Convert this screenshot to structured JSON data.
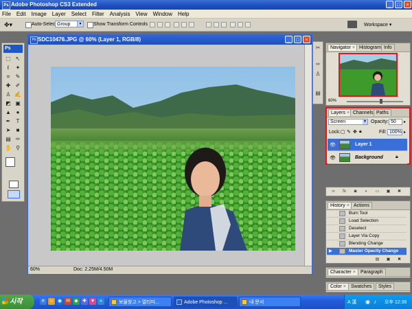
{
  "app": {
    "title": "Adobe Photoshop CS3 Extended",
    "logo": "Ps",
    "window_controls": [
      "_",
      "□",
      "×"
    ]
  },
  "menu": [
    "File",
    "Edit",
    "Image",
    "Layer",
    "Select",
    "Filter",
    "Analysis",
    "View",
    "Window",
    "Help"
  ],
  "options_bar": {
    "auto_select_label": "Auto-Select:",
    "auto_select_value": "Group",
    "show_transform_label": "Show Transform Controls",
    "workspace_label": "Workspace ▾"
  },
  "document": {
    "title": "SDC10476.JPG @ 60% (Layer 1, RGB/8)",
    "zoom": "60%",
    "doc_info": "Doc: 2.25M/4.50M"
  },
  "navigator": {
    "tabs": [
      "Navigator",
      "Histogram",
      "Info"
    ],
    "zoom": "60%"
  },
  "layers": {
    "tabs": [
      "Layers",
      "Channels",
      "Paths"
    ],
    "blend_mode": "Screen",
    "opacity_label": "Opacity:",
    "opacity_value": "50",
    "lock_label": "Lock:",
    "fill_label": "Fill:",
    "fill_value": "100%",
    "items": [
      {
        "name": "Layer 1",
        "selected": true
      },
      {
        "name": "Background",
        "selected": false
      }
    ]
  },
  "history": {
    "tabs": [
      "History",
      "Actions"
    ],
    "items": [
      "Burn Tool",
      "Load Selection",
      "Deselect",
      "Layer Via Copy",
      "Blending Change",
      "Master Opacity Change"
    ]
  },
  "character": {
    "tabs": [
      "Character",
      "Paragraph"
    ]
  },
  "color": {
    "tabs": [
      "Color",
      "Swatches",
      "Styles"
    ]
  },
  "taskbar": {
    "start_label": "시작",
    "tasks": [
      "보물창고 > 멀티미...",
      "Adobe Photoshop ...",
      "내 문서"
    ],
    "tray_lang": "A 漢",
    "clock": "오후 12:36"
  },
  "colors": {
    "title_blue": "#1d4fbf",
    "highlight_red": "#e8121c",
    "selection_blue": "#3a6fd8"
  }
}
